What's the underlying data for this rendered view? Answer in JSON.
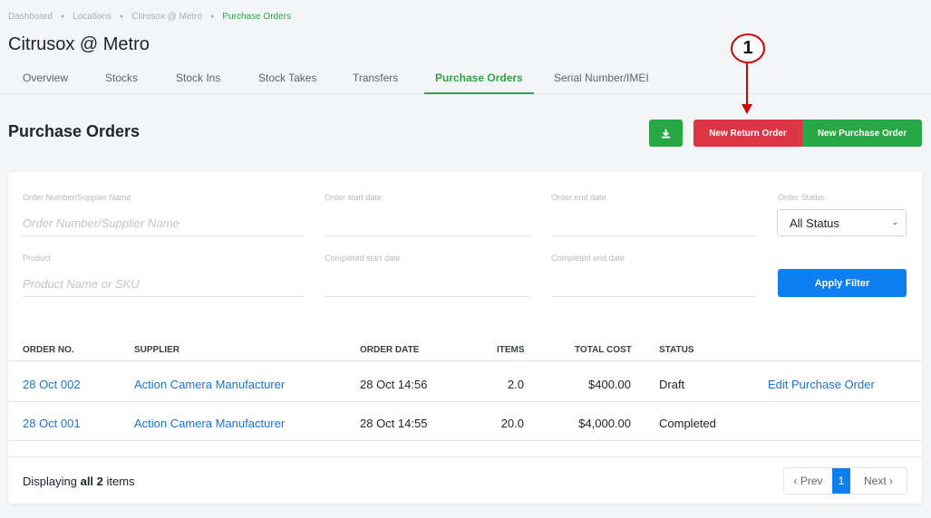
{
  "breadcrumb": [
    "Dashboard",
    "Locations",
    "Citrusox @ Metro",
    "Purchase Orders"
  ],
  "store_title": "Citrusox @ Metro",
  "tabs": [
    "Overview",
    "Stocks",
    "Stock Ins",
    "Stock Takes",
    "Transfers",
    "Purchase Orders",
    "Serial Number/IMEI"
  ],
  "active_tab": "Purchase Orders",
  "section_title": "Purchase Orders",
  "buttons": {
    "download_icon": "download-icon",
    "new_return_order": "New Return Order",
    "new_purchase_order": "New Purchase Order",
    "apply_filter": "Apply Filter"
  },
  "annotation": {
    "number": "1",
    "color": "#d10000"
  },
  "filters": {
    "order_number": {
      "label": "Order Number/Supplier Name",
      "placeholder": "Order Number/Supplier Name"
    },
    "order_start": {
      "label": "Order start date",
      "value": ""
    },
    "order_end": {
      "label": "Order end date",
      "value": ""
    },
    "order_status": {
      "label": "Order Status",
      "value": "All Status"
    },
    "product": {
      "label": "Product",
      "placeholder": "Product Name or SKU"
    },
    "completed_start": {
      "label": "Completed start date",
      "value": ""
    },
    "completed_end": {
      "label": "Completed end date",
      "value": ""
    }
  },
  "table": {
    "columns": [
      "ORDER NO.",
      "SUPPLIER",
      "ORDER DATE",
      "ITEMS",
      "TOTAL COST",
      "STATUS"
    ],
    "rows": [
      {
        "order_no": "28 Oct 002",
        "supplier": "Action Camera Manufacturer",
        "order_date": "28 Oct 14:56",
        "items": "2.0",
        "total_cost": "$400.00",
        "status": "Draft",
        "action": "Edit Purchase Order"
      },
      {
        "order_no": "28 Oct 001",
        "supplier": "Action Camera Manufacturer",
        "order_date": "28 Oct 14:55",
        "items": "20.0",
        "total_cost": "$4,000.00",
        "status": "Completed",
        "action": ""
      }
    ]
  },
  "footer": {
    "prefix": "Displaying ",
    "bold": "all 2",
    "suffix": " items"
  },
  "pagination": {
    "prev": "‹ Prev",
    "current": "1",
    "next": "Next ›"
  },
  "colors": {
    "accent_green": "#28a745",
    "danger_red": "#dc3545",
    "primary_blue": "#0d7ff0",
    "link_blue": "#1a73d9"
  }
}
